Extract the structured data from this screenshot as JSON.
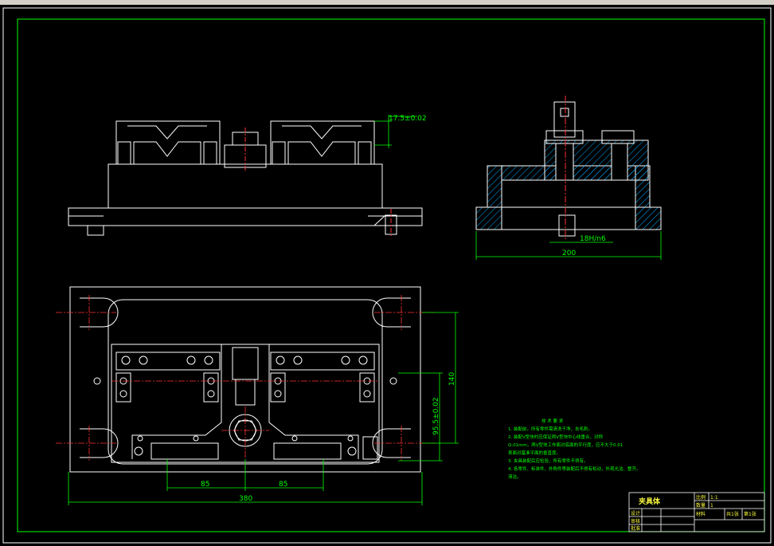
{
  "colors": {
    "background": "#000000",
    "outline": "#ffffff",
    "dimension": "#00ff00",
    "centerline": "#ff3030",
    "text_yellow": "#ffff40",
    "hatch": "#00aaff"
  },
  "dimensions": {
    "top_height": "17.5±0.02",
    "side_fit": "18H/n6",
    "side_width": "200",
    "plan_left": "85",
    "plan_right": "85",
    "plan_total": "380",
    "plan_height": "140",
    "plan_offset": "95.5±0.02"
  },
  "notes": {
    "heading": "技 术 要 求",
    "lines": [
      "1. 装配前，所有零件需清洗干净，去毛刺。",
      "2. 装配V型块时应保证两V型块中心线重合，对称",
      "Q.01mm，两V型块工作面对底面的平行度，应不大于0.01",
      "表面对基准平面的垂直度。",
      "3. 夹具装配后应检验，所有零件不得有。",
      "4. 各零件、标准件、外购件等装配后不得有松动，外观光洁、整齐。",
      "清洁。"
    ]
  },
  "title_block": {
    "title": "夹具体",
    "scale_label": "比例",
    "scale_value": "1:1",
    "qty_label": "数量",
    "qty_value": "1",
    "material_label": "材料",
    "sheet_label": "共1张",
    "page_label": "第1张",
    "row_labels": [
      "设计",
      "审核",
      "批准"
    ]
  }
}
